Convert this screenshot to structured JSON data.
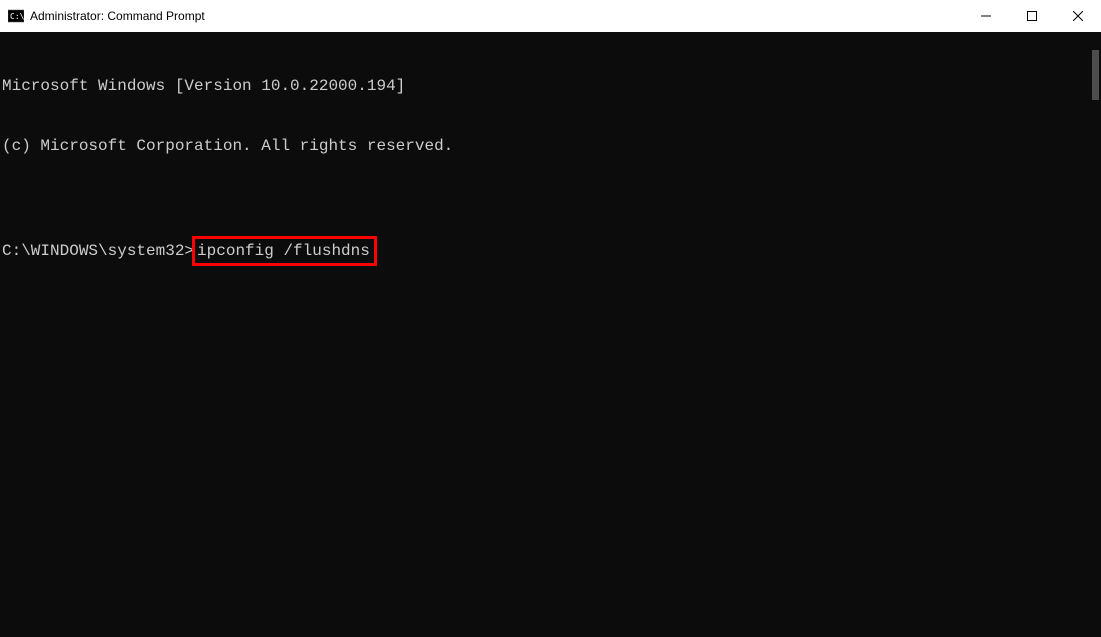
{
  "titlebar": {
    "title": "Administrator: Command Prompt"
  },
  "terminal": {
    "line1": "Microsoft Windows [Version 10.0.22000.194]",
    "line2": "(c) Microsoft Corporation. All rights reserved.",
    "blank": "",
    "prompt": "C:\\WINDOWS\\system32>",
    "command": "ipconfig /flushdns"
  }
}
